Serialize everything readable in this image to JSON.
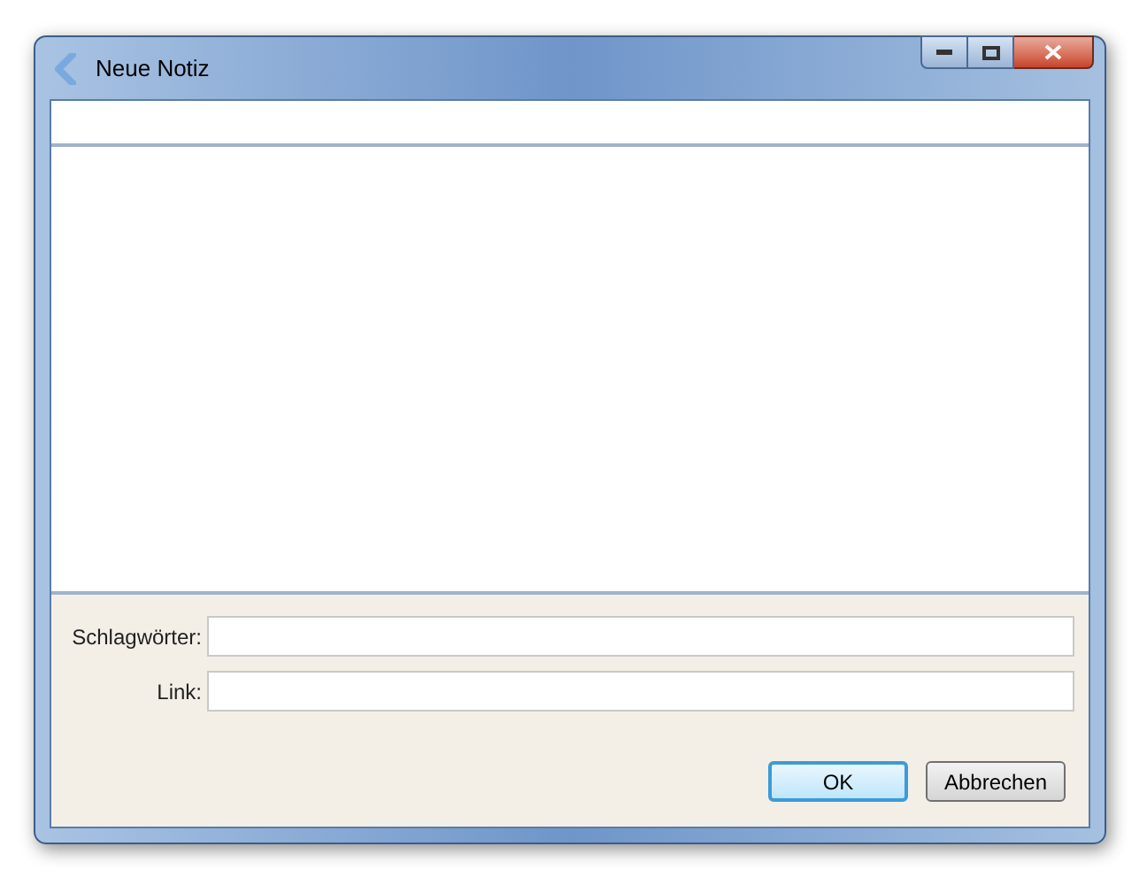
{
  "window": {
    "title": "Neue Notiz"
  },
  "fields": [
    {
      "label": "Schlagwörter:"
    },
    {
      "label": "Link:"
    }
  ],
  "buttons": [
    {
      "label": "OK",
      "default": true
    },
    {
      "label": "Abbrechen",
      "default": false
    }
  ]
}
